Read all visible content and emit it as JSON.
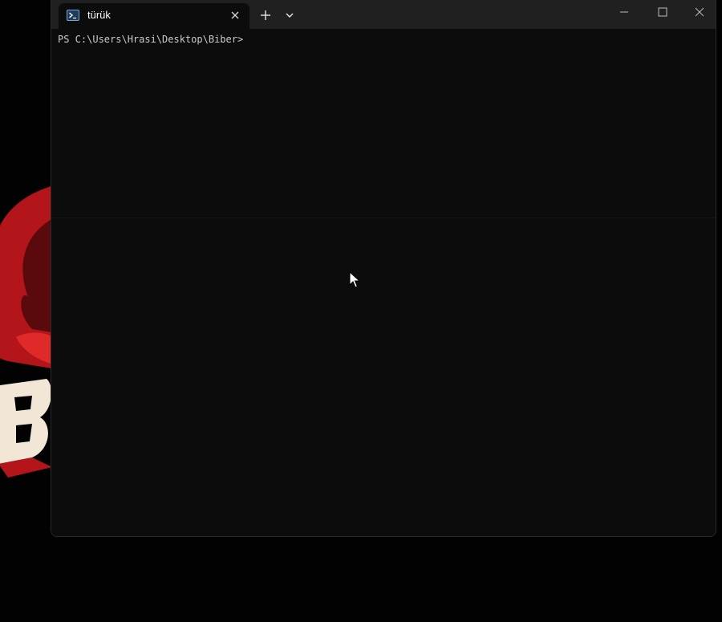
{
  "window": {
    "tab": {
      "title": "türük",
      "icon": "powershell-icon",
      "close_icon": "close-icon"
    },
    "new_tab_icon": "plus-icon",
    "dropdown_icon": "chevron-down-icon",
    "controls": {
      "minimize_icon": "minimize-icon",
      "maximize_icon": "maximize-icon",
      "close_icon": "close-icon"
    }
  },
  "terminal": {
    "prompt": "PS C:\\Users\\Hrasi\\Desktop\\Biber>"
  },
  "colors": {
    "titlebar": "#202020",
    "terminal_bg": "#0c0c0c",
    "text": "#cccccc",
    "logo_red": "#c8171d",
    "logo_cream": "#f2e6d6"
  }
}
